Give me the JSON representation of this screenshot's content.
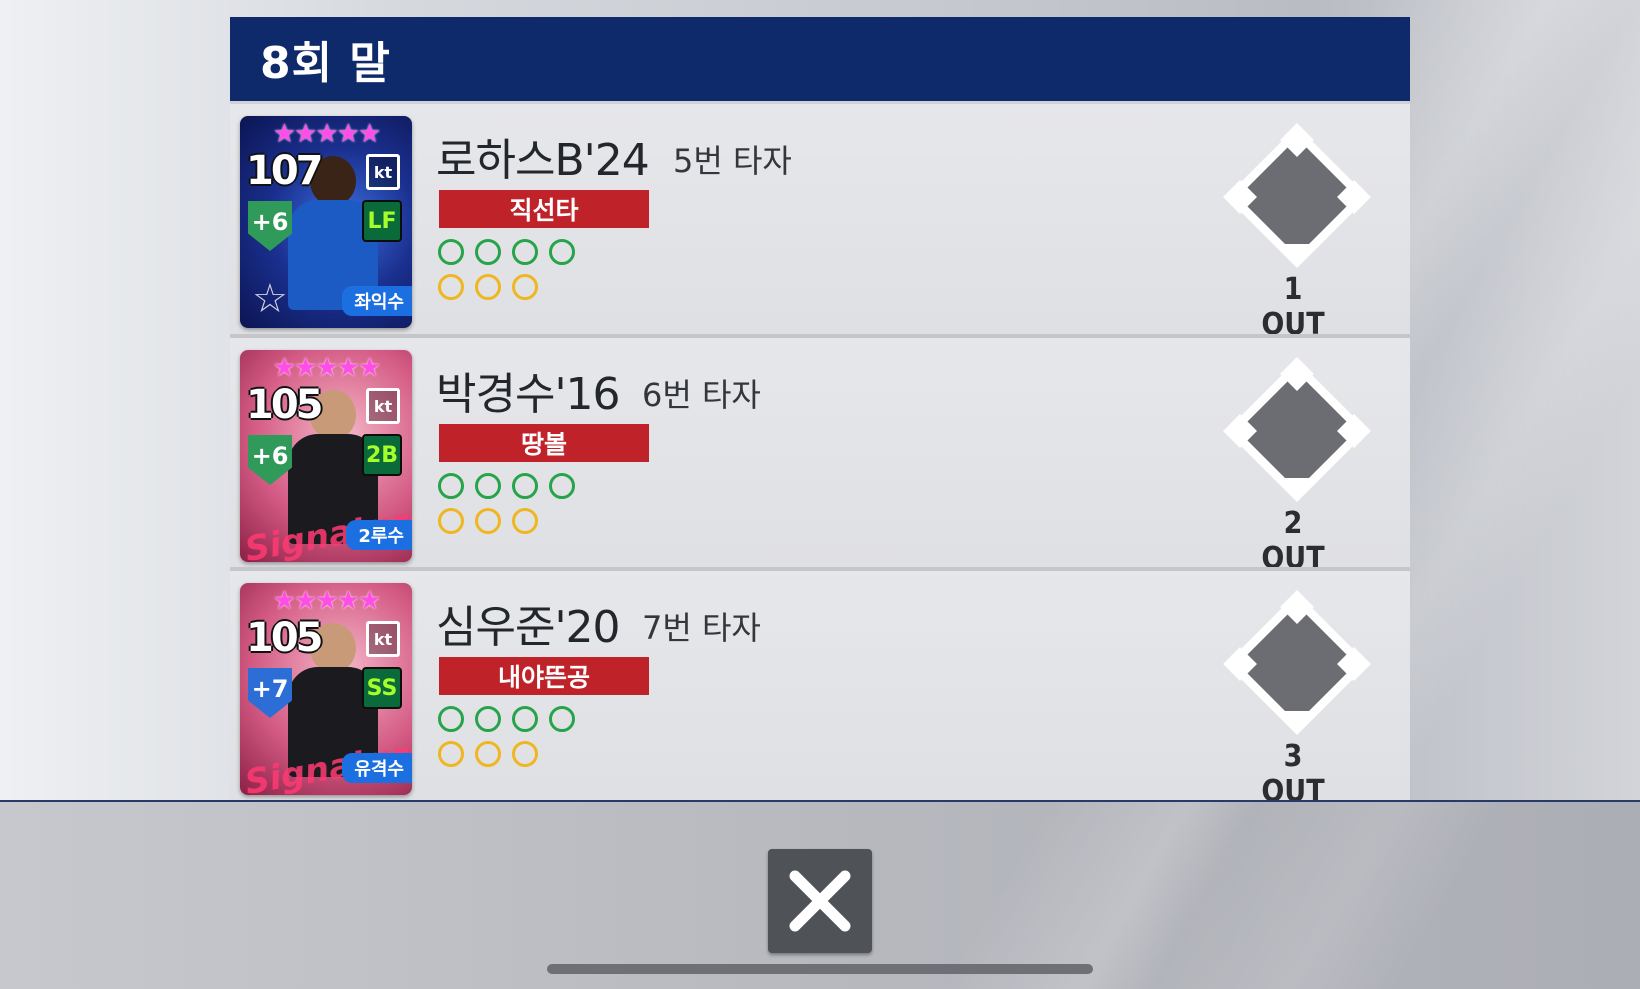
{
  "header": {
    "title": "8회 말"
  },
  "batters": [
    {
      "name": "로하스B'24",
      "order": "5번 타자",
      "result": "직선타",
      "outs": "1 OUT",
      "balls": 4,
      "strikes": 3,
      "card": {
        "style": "blue",
        "overall": "107",
        "bonus": "+6",
        "bonus_color": "green",
        "position": "LF",
        "position_name": "좌익수",
        "stars": "★★★★★"
      }
    },
    {
      "name": "박경수'16",
      "order": "6번 타자",
      "result": "땅볼",
      "outs": "2 OUT",
      "balls": 4,
      "strikes": 3,
      "card": {
        "style": "pink",
        "overall": "105",
        "bonus": "+6",
        "bonus_color": "green",
        "position": "2B",
        "position_name": "2루수",
        "stars": "★★★★★"
      }
    },
    {
      "name": "심우준'20",
      "order": "7번 타자",
      "result": "내야뜬공",
      "outs": "3 OUT",
      "balls": 4,
      "strikes": 3,
      "card": {
        "style": "pink",
        "overall": "105",
        "bonus": "+7",
        "bonus_color": "navy",
        "position": "SS",
        "position_name": "유격수",
        "stars": "★★★★★"
      }
    }
  ],
  "colors": {
    "header_bg": "#0e2a6b",
    "result_badge": "#c0222a",
    "ball_dot": "#27a34a",
    "strike_dot": "#f0b621"
  },
  "icons": {
    "close": "close-icon",
    "diamond": "base-diamond-icon"
  }
}
